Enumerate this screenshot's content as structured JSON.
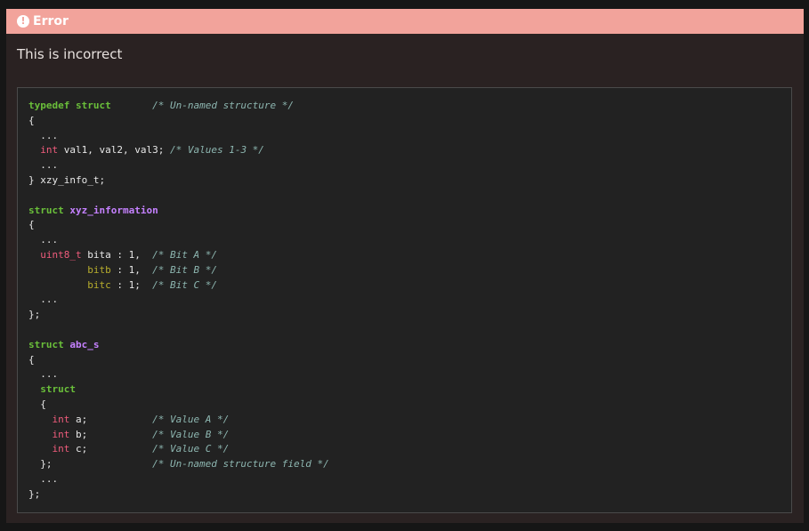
{
  "header": {
    "icon": "exclamation-circle-icon",
    "title": "Error"
  },
  "message": "This is incorrect",
  "colors": {
    "header_bg": "#f2a39b",
    "panel_bg": "#2a2222",
    "code_bg": "#222222",
    "keyword": "#6abf3a",
    "type": "#f05c7c",
    "name": "#c581ff",
    "field": "#b7ad2d",
    "comment": "#8db6b0"
  },
  "code": [
    {
      "segments": [
        {
          "cls": "kw",
          "t": "typedef"
        },
        {
          "cls": "",
          "t": " "
        },
        {
          "cls": "kw",
          "t": "struct"
        },
        {
          "cls": "",
          "t": "       "
        },
        {
          "cls": "cm",
          "t": "/* Un-named structure */"
        }
      ]
    },
    {
      "segments": [
        {
          "cls": "",
          "t": "{"
        }
      ]
    },
    {
      "segments": [
        {
          "cls": "",
          "t": "  ..."
        }
      ]
    },
    {
      "segments": [
        {
          "cls": "",
          "t": "  "
        },
        {
          "cls": "ty",
          "t": "int"
        },
        {
          "cls": "",
          "t": " val1, val2, val3; "
        },
        {
          "cls": "cm",
          "t": "/* Values 1-3 */"
        }
      ]
    },
    {
      "segments": [
        {
          "cls": "",
          "t": "  ..."
        }
      ]
    },
    {
      "segments": [
        {
          "cls": "",
          "t": "} xzy_info_t;"
        }
      ]
    },
    {
      "segments": [
        {
          "cls": "",
          "t": ""
        }
      ]
    },
    {
      "segments": [
        {
          "cls": "kw",
          "t": "struct"
        },
        {
          "cls": "",
          "t": " "
        },
        {
          "cls": "nm",
          "t": "xyz_information"
        }
      ]
    },
    {
      "segments": [
        {
          "cls": "",
          "t": "{"
        }
      ]
    },
    {
      "segments": [
        {
          "cls": "",
          "t": "  ..."
        }
      ]
    },
    {
      "segments": [
        {
          "cls": "",
          "t": "  "
        },
        {
          "cls": "ty",
          "t": "uint8_t"
        },
        {
          "cls": "",
          "t": " bita : 1,  "
        },
        {
          "cls": "cm",
          "t": "/* Bit A */"
        }
      ]
    },
    {
      "segments": [
        {
          "cls": "",
          "t": "          "
        },
        {
          "cls": "fd",
          "t": "bitb"
        },
        {
          "cls": "",
          "t": " : 1,  "
        },
        {
          "cls": "cm",
          "t": "/* Bit B */"
        }
      ]
    },
    {
      "segments": [
        {
          "cls": "",
          "t": "          "
        },
        {
          "cls": "fd",
          "t": "bitc"
        },
        {
          "cls": "",
          "t": " : 1;  "
        },
        {
          "cls": "cm",
          "t": "/* Bit C */"
        }
      ]
    },
    {
      "segments": [
        {
          "cls": "",
          "t": "  ..."
        }
      ]
    },
    {
      "segments": [
        {
          "cls": "",
          "t": "};"
        }
      ]
    },
    {
      "segments": [
        {
          "cls": "",
          "t": ""
        }
      ]
    },
    {
      "segments": [
        {
          "cls": "kw",
          "t": "struct"
        },
        {
          "cls": "",
          "t": " "
        },
        {
          "cls": "nm",
          "t": "abc_s"
        }
      ]
    },
    {
      "segments": [
        {
          "cls": "",
          "t": "{"
        }
      ]
    },
    {
      "segments": [
        {
          "cls": "",
          "t": "  ..."
        }
      ]
    },
    {
      "segments": [
        {
          "cls": "",
          "t": "  "
        },
        {
          "cls": "kw",
          "t": "struct"
        }
      ]
    },
    {
      "segments": [
        {
          "cls": "",
          "t": "  {"
        }
      ]
    },
    {
      "segments": [
        {
          "cls": "",
          "t": "    "
        },
        {
          "cls": "ty",
          "t": "int"
        },
        {
          "cls": "",
          "t": " a;           "
        },
        {
          "cls": "cm",
          "t": "/* Value A */"
        }
      ]
    },
    {
      "segments": [
        {
          "cls": "",
          "t": "    "
        },
        {
          "cls": "ty",
          "t": "int"
        },
        {
          "cls": "",
          "t": " b;           "
        },
        {
          "cls": "cm",
          "t": "/* Value B */"
        }
      ]
    },
    {
      "segments": [
        {
          "cls": "",
          "t": "    "
        },
        {
          "cls": "ty",
          "t": "int"
        },
        {
          "cls": "",
          "t": " c;           "
        },
        {
          "cls": "cm",
          "t": "/* Value C */"
        }
      ]
    },
    {
      "segments": [
        {
          "cls": "",
          "t": "  };                 "
        },
        {
          "cls": "cm",
          "t": "/* Un-named structure field */"
        }
      ]
    },
    {
      "segments": [
        {
          "cls": "",
          "t": "  ..."
        }
      ]
    },
    {
      "segments": [
        {
          "cls": "",
          "t": "};"
        }
      ]
    }
  ]
}
